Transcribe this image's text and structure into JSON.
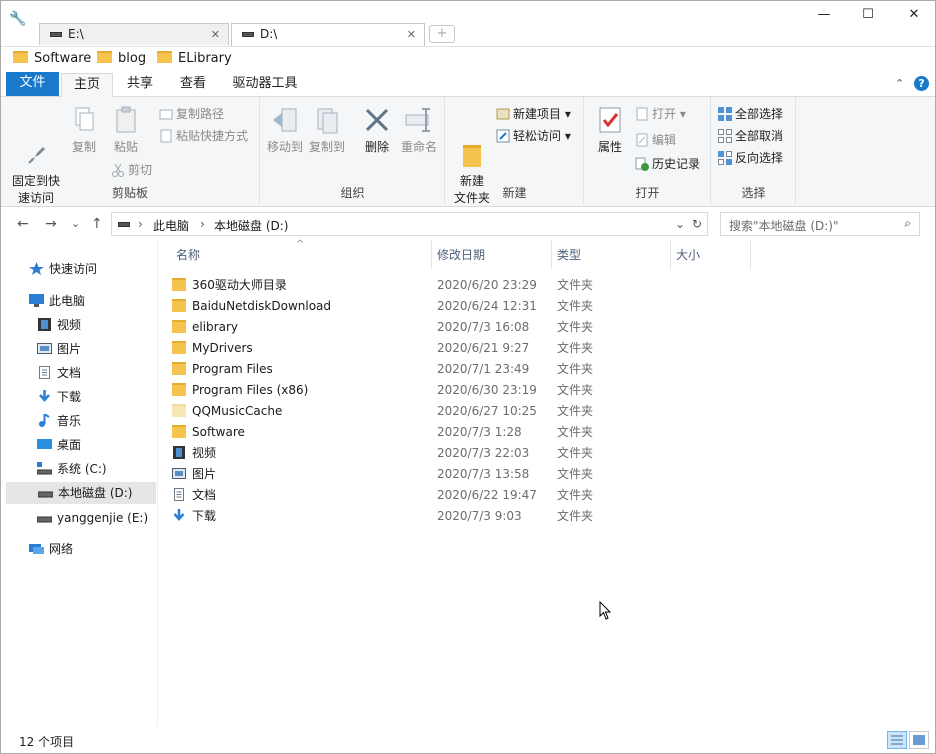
{
  "window": {
    "controls": {
      "minimize": "—",
      "maximize": "☐",
      "close": "✕"
    },
    "tabs": [
      {
        "label": "E:\\",
        "close": "✕"
      },
      {
        "label": "D:\\",
        "close": "✕"
      }
    ],
    "new_tab": "+"
  },
  "favorites": [
    {
      "label": "Software"
    },
    {
      "label": "blog"
    },
    {
      "label": "ELibrary"
    }
  ],
  "ribbon_tabs": [
    {
      "label": "文件"
    },
    {
      "label": "主页"
    },
    {
      "label": "共享"
    },
    {
      "label": "查看"
    },
    {
      "label": "驱动器工具"
    }
  ],
  "ribbon_controls": {
    "expand": "⌃",
    "help": "?"
  },
  "ribbon": {
    "clipboard": {
      "label": "剪贴板",
      "pin": "固定到快\n速访问",
      "copy": "复制",
      "paste": "粘贴",
      "copy_path": "复制路径",
      "paste_shortcut": "粘贴快捷方式",
      "cut": "剪切"
    },
    "organize": {
      "label": "组织",
      "move_to": "移动到",
      "copy_to": "复制到",
      "delete": "删除",
      "rename": "重命名"
    },
    "new": {
      "label": "新建",
      "new_folder": "新建\n文件夹",
      "new_item": "新建项目 ▾",
      "easy_access": "轻松访问 ▾"
    },
    "open": {
      "label": "打开",
      "properties": "属性",
      "open": "打开 ▾",
      "edit": "编辑",
      "history": "历史记录"
    },
    "select": {
      "label": "选择",
      "select_all": "全部选择",
      "select_none": "全部取消",
      "invert": "反向选择"
    }
  },
  "address": {
    "back": "←",
    "forward": "→",
    "recent": "⌄",
    "up": "↑",
    "crumbs": [
      "此电脑",
      "本地磁盘 (D:)"
    ],
    "separator": "›",
    "dropdown": "⌄",
    "refresh": "↻",
    "search_placeholder": "搜索\"本地磁盘 (D:)\""
  },
  "nav": [
    {
      "label": "快速访问",
      "icon": "star-icon"
    },
    {
      "label": "此电脑",
      "icon": "computer-icon"
    },
    {
      "label": "视频",
      "icon": "video-icon"
    },
    {
      "label": "图片",
      "icon": "picture-icon"
    },
    {
      "label": "文档",
      "icon": "document-icon"
    },
    {
      "label": "下载",
      "icon": "download-icon"
    },
    {
      "label": "音乐",
      "icon": "music-icon"
    },
    {
      "label": "桌面",
      "icon": "desktop-icon"
    },
    {
      "label": "系统 (C:)",
      "icon": "system-drive-icon"
    },
    {
      "label": "本地磁盘 (D:)",
      "icon": "drive-icon"
    },
    {
      "label": "yanggenjie (E:)",
      "icon": "drive-icon"
    },
    {
      "label": "网络",
      "icon": "network-icon"
    }
  ],
  "columns": {
    "name": "名称",
    "modified": "修改日期",
    "type": "类型",
    "size": "大小",
    "sort_indicator": "^"
  },
  "files": [
    {
      "name": "360驱动大师目录",
      "date": "2020/6/20 23:29",
      "type": "文件夹",
      "icon": "folder-icon"
    },
    {
      "name": "BaiduNetdiskDownload",
      "date": "2020/6/24 12:31",
      "type": "文件夹",
      "icon": "folder-icon"
    },
    {
      "name": "elibrary",
      "date": "2020/7/3 16:08",
      "type": "文件夹",
      "icon": "folder-icon"
    },
    {
      "name": "MyDrivers",
      "date": "2020/6/21 9:27",
      "type": "文件夹",
      "icon": "folder-icon"
    },
    {
      "name": "Program Files",
      "date": "2020/7/1 23:49",
      "type": "文件夹",
      "icon": "folder-icon"
    },
    {
      "name": "Program Files (x86)",
      "date": "2020/6/30 23:19",
      "type": "文件夹",
      "icon": "folder-icon"
    },
    {
      "name": "QQMusicCache",
      "date": "2020/6/27 10:25",
      "type": "文件夹",
      "icon": "hidden-folder-icon"
    },
    {
      "name": "Software",
      "date": "2020/7/3 1:28",
      "type": "文件夹",
      "icon": "folder-icon"
    },
    {
      "name": "视频",
      "date": "2020/7/3 22:03",
      "type": "文件夹",
      "icon": "video-icon"
    },
    {
      "name": "图片",
      "date": "2020/7/3 13:58",
      "type": "文件夹",
      "icon": "picture-icon"
    },
    {
      "name": "文档",
      "date": "2020/6/22 19:47",
      "type": "文件夹",
      "icon": "document-icon"
    },
    {
      "name": "下载",
      "date": "2020/7/3 9:03",
      "type": "文件夹",
      "icon": "download-icon"
    }
  ],
  "status": {
    "count": "12 个项目"
  },
  "colors": {
    "accent": "#1979ca",
    "folder": "#f4c44e",
    "selected_nav": "#e5e5e5"
  }
}
